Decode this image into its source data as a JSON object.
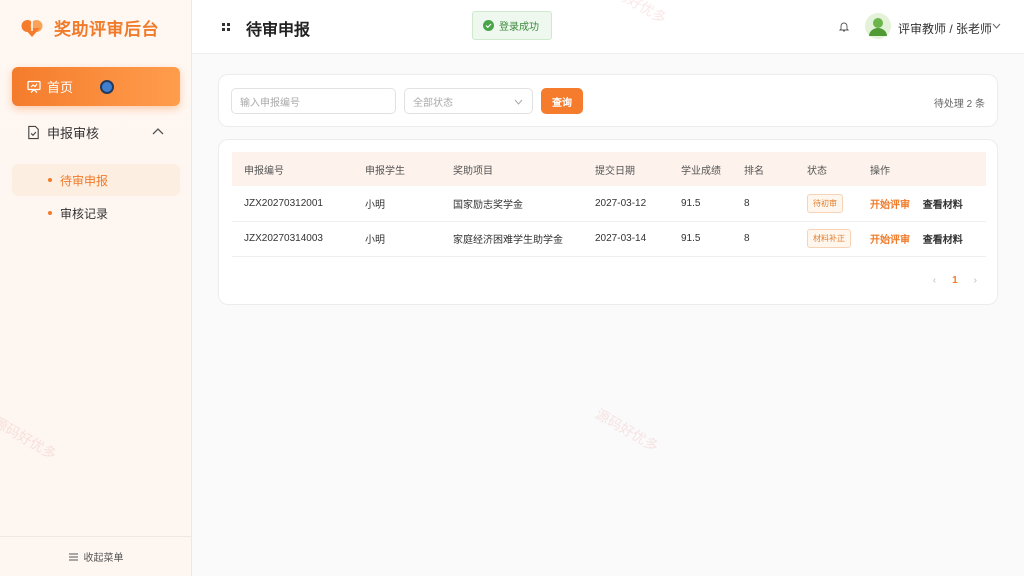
{
  "brand": {
    "name": "奖助评审后台"
  },
  "sidebar": {
    "home_label": "首页",
    "group_label": "申报审核",
    "items": [
      {
        "label": "待审申报",
        "active": true
      },
      {
        "label": "审核记录",
        "active": false
      }
    ],
    "collapse_label": "收起菜单"
  },
  "header": {
    "title": "待审申报",
    "toast": "登录成功",
    "user": "评审教师 / 张老师"
  },
  "filters": {
    "search_placeholder": "输入申报编号",
    "status_placeholder": "全部状态",
    "query_label": "查询",
    "pending_text": "待处理 2 条"
  },
  "table": {
    "headers": [
      "申报编号",
      "申报学生",
      "奖助项目",
      "提交日期",
      "学业成绩",
      "排名",
      "状态",
      "操作"
    ],
    "rows": [
      {
        "id": "JZX20270312001",
        "student": "小明",
        "project": "国家励志奖学金",
        "date": "2027-03-12",
        "score": "91.5",
        "rank": "8",
        "status": "待初审",
        "action1": "开始评审",
        "action2": "查看材料"
      },
      {
        "id": "JZX20270314003",
        "student": "小明",
        "project": "家庭经济困难学生助学金",
        "date": "2027-03-14",
        "score": "91.5",
        "rank": "8",
        "status": "材料补正",
        "action1": "开始评审",
        "action2": "查看材料"
      }
    ]
  },
  "pager": {
    "prev": "‹",
    "current": "1",
    "next": "›"
  },
  "watermarks": [
    "源码好优多",
    "源码好优多",
    "源码好优多"
  ],
  "colors": {
    "accent": "#f47c2c",
    "success": "#3d8a3d"
  }
}
